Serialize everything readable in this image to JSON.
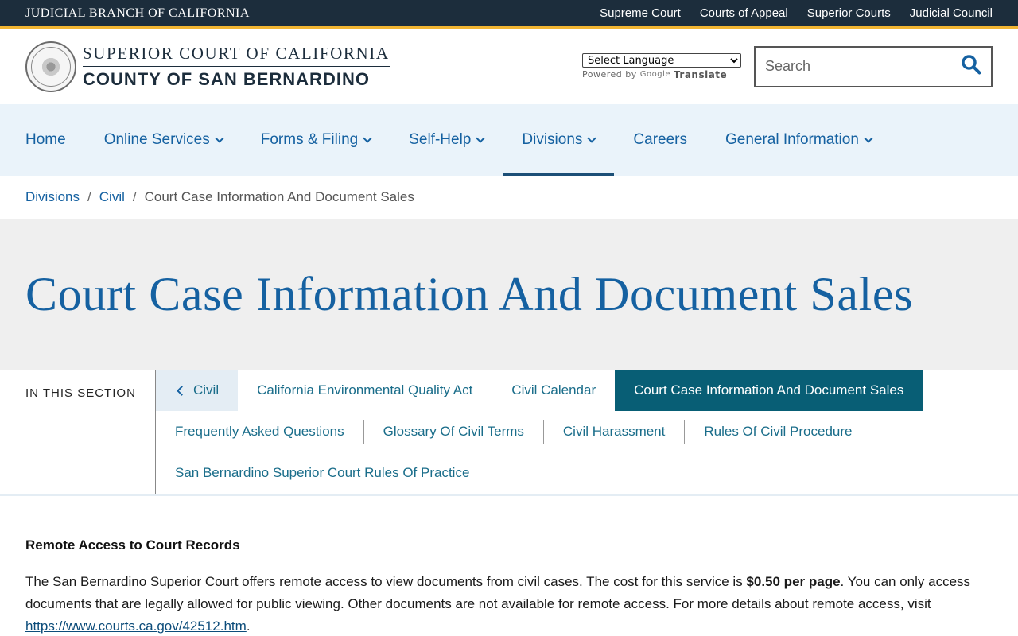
{
  "topbar": {
    "brand": "JUDICIAL BRANCH OF CALIFORNIA",
    "links": [
      "Supreme Court",
      "Courts of Appeal",
      "Superior Courts",
      "Judicial Council"
    ]
  },
  "header": {
    "logo_line1": "SUPERIOR COURT OF CALIFORNIA",
    "logo_line2": "COUNTY OF SAN BERNARDINO",
    "language_select": "Select Language",
    "powered_by": "Powered by",
    "google": "Google",
    "translate": "Translate",
    "search_placeholder": "Search",
    "search_icon": "search-icon"
  },
  "nav": {
    "items": [
      {
        "label": "Home"
      },
      {
        "label": "Online Services"
      },
      {
        "label": "Forms & Filing"
      },
      {
        "label": "Self-Help"
      },
      {
        "label": "Divisions"
      },
      {
        "label": "Careers"
      },
      {
        "label": "General Information"
      }
    ]
  },
  "breadcrumb": {
    "items": [
      "Divisions",
      "Civil"
    ],
    "current": "Court Case Information And Document Sales",
    "separator": "/"
  },
  "page": {
    "title": "Court Case Information And Document Sales"
  },
  "section_nav": {
    "label": "IN THIS SECTION",
    "back": "Civil",
    "links": [
      "California Environmental Quality Act",
      "Civil Calendar",
      "Court Case Information And Document Sales",
      "Frequently Asked Questions",
      "Glossary Of Civil Terms",
      "Civil Harassment",
      "Rules Of Civil Procedure",
      "San Bernardino Superior Court Rules Of Practice"
    ]
  },
  "content": {
    "heading": "Remote Access to Court Records",
    "para_start": "The San Bernardino Superior Court offers remote access to view documents from civil cases. The cost for this service is ",
    "para_bold": "$0.50 per page",
    "para_mid": ". You can only access documents that are legally allowed for public viewing. Other documents are not available for remote access. For more details about remote access, visit ",
    "para_link": "https://www.courts.ca.gov/42512.htm",
    "para_end": "."
  },
  "colors": {
    "topbar_bg": "#1c2d3c",
    "accent_gold": "#f2b532",
    "link_blue": "#1561a1",
    "current_tab_bg": "#085e75"
  }
}
